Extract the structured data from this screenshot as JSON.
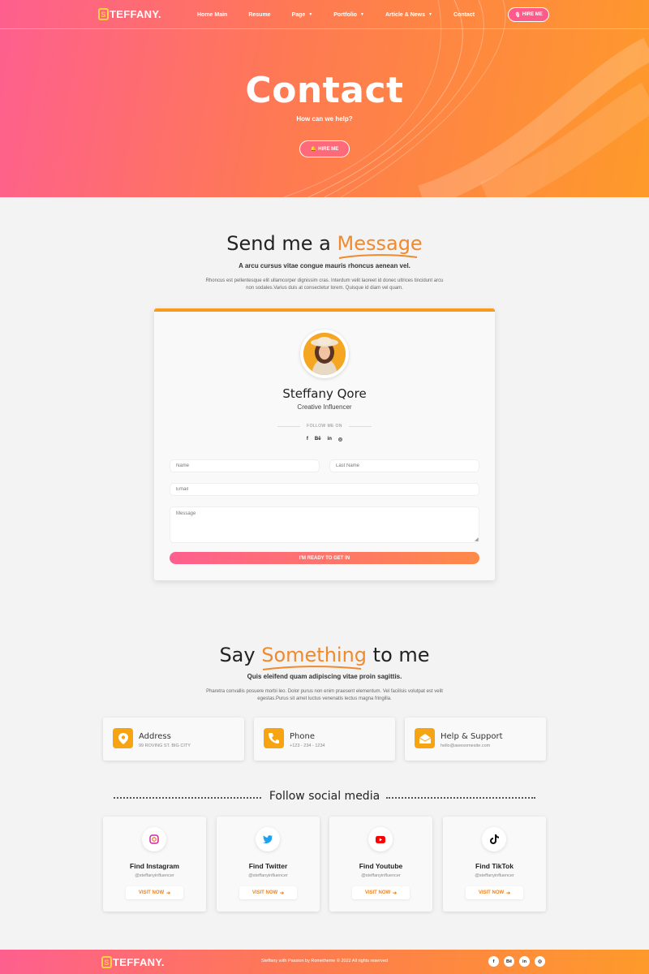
{
  "brand": {
    "logo_letter": "S",
    "logo_text": "TEFFANY."
  },
  "nav": {
    "items": [
      {
        "label": "Home Main",
        "dropdown": false
      },
      {
        "label": "Resume",
        "dropdown": false
      },
      {
        "label": "Page",
        "dropdown": true
      },
      {
        "label": "Portfolio",
        "dropdown": true
      },
      {
        "label": "Article & News",
        "dropdown": true
      },
      {
        "label": "Contact",
        "dropdown": false
      }
    ],
    "hire_label": "HIRE ME"
  },
  "hero": {
    "title": "Contact",
    "subtitle": "How can we help?",
    "hire_label": "HIRE ME"
  },
  "message_section": {
    "title_prefix": "Send me a",
    "title_highlight": "Message",
    "lead": "A arcu cursus vitae congue mauris rhoncus aenean vel.",
    "paragraph": "Rhoncus est pellentesque elit ullamcorper dignissim cras. Interdum velit laoreet id donec ultrices tincidunt arcu non sodales.Varius duis at consectetur lorem. Quisque id diam vel quam."
  },
  "profile": {
    "name": "Steffany Qore",
    "role": "Creative Influencer",
    "follow_label": "FOLLOW ME ON",
    "socials": [
      "f",
      "Bē",
      "in",
      "◎"
    ]
  },
  "form": {
    "name_placeholder": "Name",
    "last_name_placeholder": "Last Name",
    "email_placeholder": "Email",
    "message_placeholder": "Message",
    "submit_label": "I'M READY TO GET IN"
  },
  "say_section": {
    "title_prefix": "Say",
    "title_highlight": "Something",
    "title_suffix": "to me",
    "lead": "Quis eleifend quam adipiscing vitae proin sagittis.",
    "paragraph": "Pharetra convallis posuere morbi leo. Dolor purus non enim praesent elementum. Vel facilisis volutpat est velit egestas.Purus sit amet luctus venenatis lectus magna fringilla."
  },
  "contacts": [
    {
      "title": "Address",
      "value": "99 ROVING ST. BIG CITY",
      "icon": "location-pin-icon"
    },
    {
      "title": "Phone",
      "value": "+123 - 234 - 1234",
      "icon": "phone-icon"
    },
    {
      "title": "Help & Support",
      "value": "hello@awesomesite.com",
      "icon": "envelope-icon"
    }
  ],
  "social_media": {
    "heading": "Follow social media",
    "cards": [
      {
        "name": "Find Instagram",
        "handle": "@steffanyinfluencer",
        "button": "VISIT NOW",
        "icon": "instagram-icon"
      },
      {
        "name": "Find Twitter",
        "handle": "@steffanyinfluencer",
        "button": "VISIT NOW",
        "icon": "twitter-icon"
      },
      {
        "name": "Find Youtube",
        "handle": "@steffanyinfluencer",
        "button": "VISIT NOW",
        "icon": "youtube-icon"
      },
      {
        "name": "Find TikTok",
        "handle": "@steffanyinfluencer",
        "button": "VISIT NOW",
        "icon": "tiktok-icon"
      }
    ]
  },
  "footer": {
    "copyright": "Steffany with Passion by Rometheme © 2022 All rights reserved",
    "socials": [
      "f",
      "Bē",
      "in",
      "◎"
    ]
  },
  "colors": {
    "accent": "#f08a2e",
    "gradient_start": "#fe5f8f",
    "gradient_end": "#fe9a2a",
    "icon_bg": "#f7a413"
  }
}
